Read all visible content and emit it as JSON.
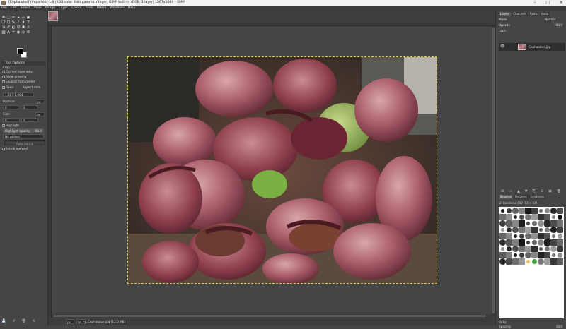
{
  "window": {
    "title": "[Cephalotus] (imported)-1.0 (RGB color 8-bit gamma integer, GIMP built-in sRGB, 1 layer) 1567x1064 – GIMP",
    "controls": [
      "–",
      "□",
      "✕"
    ]
  },
  "menu": [
    "File",
    "Edit",
    "Select",
    "View",
    "Image",
    "Layer",
    "Colors",
    "Tools",
    "Filters",
    "Windows",
    "Help"
  ],
  "toolbox": {
    "tools": [
      "✥",
      "⬚",
      "✂",
      "⌖",
      "⊹",
      "▣",
      "❒",
      "⬡",
      "✎",
      "⌇",
      "✦",
      "T",
      "⇲",
      "✐",
      "◐",
      "⚲",
      "✚",
      "⚪",
      "▨",
      "A",
      "♒",
      "◉",
      "◎",
      "⚙"
    ],
    "options": {
      "title": "Tool Options",
      "tool_name": "Crop",
      "current_layer_only": "Current layer only",
      "allow_growing": "Allow growing",
      "expand_from_center": "Expand from center",
      "fixed_label": "Fixed",
      "fixed_value": "Aspect ratio",
      "ratio_value": "1,567:1,064",
      "position_label": "Position:",
      "position_unit": "px",
      "position_x": "0",
      "position_y": "0",
      "size_label": "Size:",
      "size_unit": "px",
      "size_w": "0",
      "size_h": "0",
      "highlight_label": "Highlight",
      "highlight_opacity_label": "Highlight opacity",
      "highlight_opacity_value": "50.0",
      "guides_value": "No guides",
      "auto_shrink": "Auto Shrink",
      "shrink_merged": "Shrink merged"
    },
    "bottom_icons": [
      "💾",
      "↺",
      "🗑",
      "⟲"
    ]
  },
  "image_window": {
    "statusbar": {
      "unit": "px",
      "zoom": "66.7%",
      "message": "Cephalotus.jpg (13.0 MB)"
    }
  },
  "dock": {
    "top_tabs": [
      "Layers",
      "Channels",
      "Paths",
      "Undo"
    ],
    "mode_label": "Mode",
    "mode_value": "Normal",
    "opacity_label": "Opacity",
    "opacity_value": "100.0",
    "lock_label": "Lock:",
    "layer_name": "Cephalotus.jpg",
    "layer_buttons": [
      "⊞",
      "▭",
      "▲",
      "▼",
      "⎘",
      "⚓",
      "▣",
      "🗑"
    ],
    "brush_tabs": [
      "Brushes",
      "Patterns",
      "Gradients"
    ],
    "brush_name": "2. Hardness 050 (51 × 51)",
    "brush_tag": "Basic",
    "spacing_label": "Spacing",
    "spacing_value": "10.0"
  }
}
